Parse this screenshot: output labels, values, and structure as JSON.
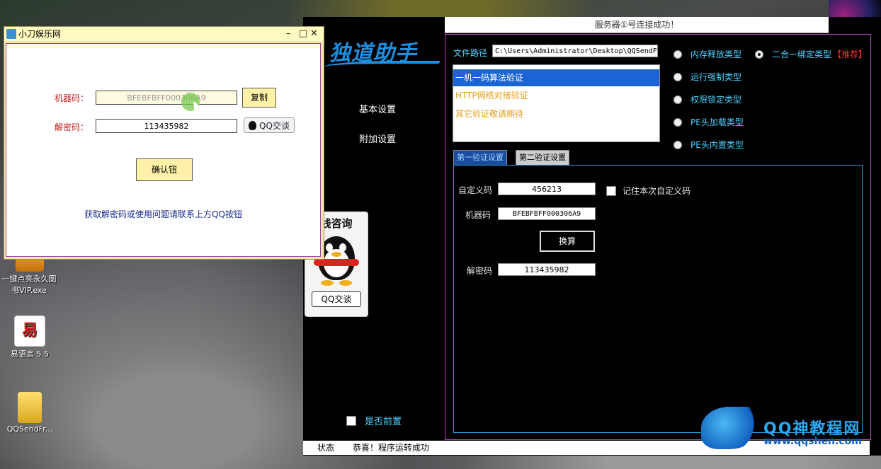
{
  "desktop": {
    "icons": [
      {
        "label": "一键点亮永久图书VIP.exe"
      },
      {
        "label": "易语言 5.5"
      },
      {
        "label": "QQSendFr..."
      }
    ]
  },
  "app": {
    "server_status": "服务器①号连接成功！",
    "logo": "独道助手",
    "nav": {
      "basic": "基本设置",
      "extra": "附加设置"
    },
    "topmost_label": "是否前置",
    "file_path_label": "文件路径",
    "file_path_value": "C:\\Users\\Administrator\\Desktop\\QQSendFr",
    "verify_list": [
      "一机一码算法验证",
      "HTTP网络对接验证",
      "其它验证敬请期待"
    ],
    "radios_col1": [
      "内存释放类型",
      "运行强制类型",
      "权限锁定类型",
      "PE头加载类型",
      "PE头内置类型"
    ],
    "radio_col2": "二合一绑定类型",
    "radio_col2_tag": "【推荐】",
    "tabs": [
      "第一验证设置",
      "第二验证设置"
    ],
    "fields": {
      "custom_label": "自定义码",
      "custom_value": "456213",
      "remember_label": "记住本次自定义码",
      "machine_label": "机器码",
      "machine_value": "BFEBFBFF000306A9",
      "calc_label": "换算",
      "unlock_label": "解密码",
      "unlock_value": "113435982"
    },
    "status_bar": {
      "label": "状态",
      "message": "恭喜！程序运转成功"
    }
  },
  "qq_card": {
    "title": "线咨询",
    "button": "QQ交谈"
  },
  "dialog": {
    "title": "小刀娱乐网",
    "machine_label": "机器码：",
    "machine_value": "BFEBFBFF000306A9",
    "copy_label": "复制",
    "unlock_label": "解密码：",
    "unlock_value": "113435982",
    "qq_label": "QQ交谈",
    "confirm_label": "确认钮",
    "hint": "获取解密码或使用问题请联系上方QQ按钮"
  },
  "watermark": {
    "text": "QQ神教程网",
    "url": "www.qqshen.com"
  },
  "colors": {
    "accent_blue": "#1d8fe0",
    "label_cyan": "#4fd0ff",
    "dialog_red": "#c02020",
    "panel_magenta": "#c03cc0"
  }
}
